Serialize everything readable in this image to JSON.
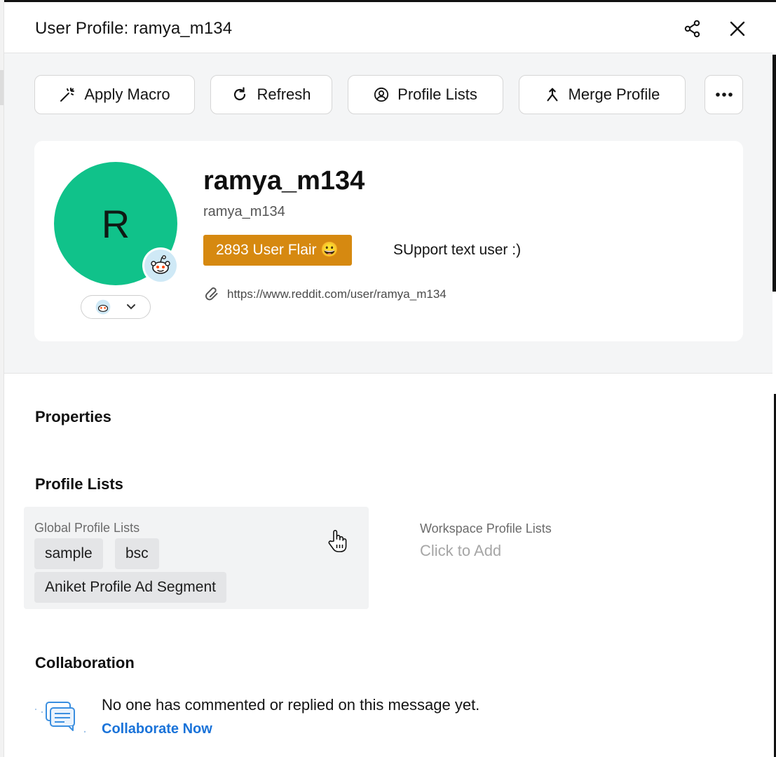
{
  "header": {
    "title": "User Profile: ramya_m134",
    "share_icon": "share-icon",
    "close_icon": "close-icon"
  },
  "toolbar": {
    "apply_macro": "Apply Macro",
    "refresh": "Refresh",
    "profile_lists": "Profile Lists",
    "merge_profile": "Merge Profile",
    "more_icon": "more-horizontal-icon"
  },
  "profile": {
    "avatar_initial": "R",
    "display_name": "ramya_m134",
    "username": "ramya_m134",
    "flair": "2893 User Flair 😀",
    "flair_text": "SUpport text user :)",
    "link": "https://www.reddit.com/user/ramya_m134",
    "source_icon": "reddit-icon",
    "colors": {
      "avatar": "#10c28a",
      "flair": "#d68910"
    }
  },
  "properties": {
    "heading": "Properties"
  },
  "profile_lists": {
    "heading": "Profile Lists",
    "global_label": "Global Profile Lists",
    "global_chips": [
      "sample",
      "bsc",
      "Aniket Profile Ad Segment"
    ],
    "workspace_label": "Workspace Profile Lists",
    "workspace_placeholder": "Click to Add"
  },
  "collaboration": {
    "heading": "Collaboration",
    "empty_text": "No one has commented or replied on this message yet.",
    "cta": "Collaborate Now",
    "link_color": "#1a73d9"
  }
}
